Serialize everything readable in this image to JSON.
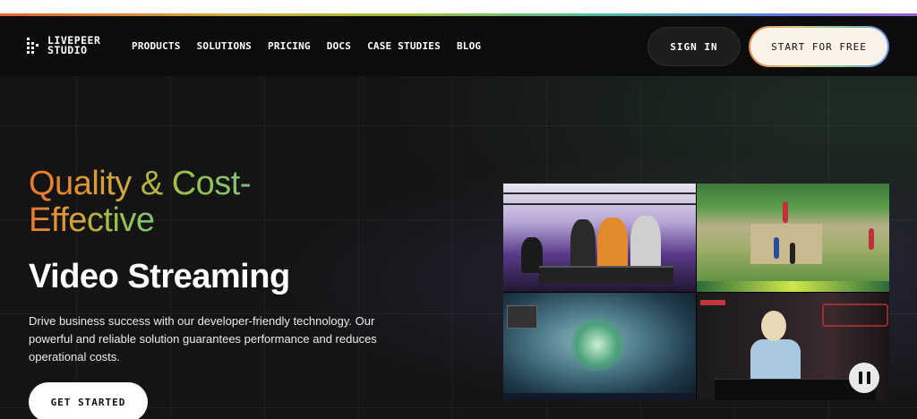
{
  "brand": {
    "line1": "LIVEPEER",
    "line2": "STUDIO"
  },
  "nav": {
    "items": [
      {
        "label": "PRODUCTS"
      },
      {
        "label": "SOLUTIONS"
      },
      {
        "label": "PRICING"
      },
      {
        "label": "DOCS"
      },
      {
        "label": "CASE STUDIES"
      },
      {
        "label": "BLOG"
      }
    ],
    "sign_in_label": "SIGN IN",
    "start_free_label": "START FOR FREE"
  },
  "hero": {
    "headline_gradient_1": "Quality & Cost-",
    "headline_gradient_2": "Effective",
    "headline_white": "Video Streaming",
    "description": "Drive business success with our developer-friendly technology. Our powerful and reliable solution guarantees performance and reduces operational costs.",
    "cta_label": "GET STARTED"
  },
  "colors": {
    "background": "#141414",
    "navbar": "#0c0c0c",
    "gradient_start": "#e8782f",
    "gradient_end": "#7dc27a",
    "cta_background": "#ffffff"
  },
  "icons": {
    "logo": "livepeer-dots-icon",
    "pause": "pause-icon"
  }
}
